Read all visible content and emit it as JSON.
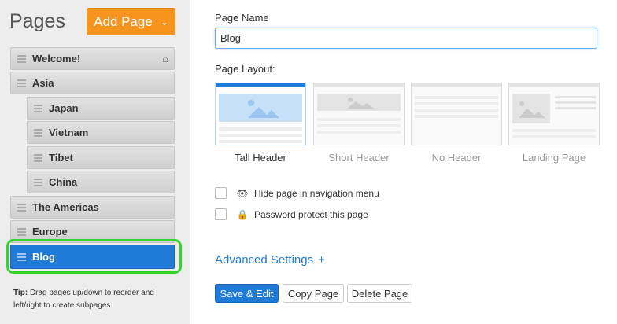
{
  "sidebar": {
    "title": "Pages",
    "add_page_label": "Add Page",
    "pages": [
      {
        "label": "Welcome!",
        "level": 0,
        "home": true
      },
      {
        "label": "Asia",
        "level": 0
      },
      {
        "label": "Japan",
        "level": 1
      },
      {
        "label": "Vietnam",
        "level": 1
      },
      {
        "label": "Tibet",
        "level": 1
      },
      {
        "label": "China",
        "level": 1
      },
      {
        "label": "The Americas",
        "level": 0
      },
      {
        "label": "Europe",
        "level": 0
      },
      {
        "label": "Blog",
        "level": 0,
        "active": true
      }
    ],
    "tip_label": "Tip:",
    "tip_text": "Drag pages up/down to reorder and left/right to create subpages."
  },
  "main": {
    "page_name_label": "Page Name",
    "page_name_value": "Blog",
    "page_layout_label": "Page Layout:",
    "layouts": [
      {
        "label": "Tall Header",
        "selected": true
      },
      {
        "label": "Short Header",
        "selected": false
      },
      {
        "label": "No Header",
        "selected": false
      },
      {
        "label": "Landing Page",
        "selected": false
      }
    ],
    "hide_nav_label": "Hide page in navigation menu",
    "password_label": "Password protect this page",
    "advanced_label": "Advanced Settings",
    "advanced_plus": "+",
    "save_label": "Save & Edit",
    "copy_label": "Copy Page",
    "delete_label": "Delete Page"
  },
  "colors": {
    "accent": "#1f7ad8",
    "add_button": "#f6941d",
    "active_highlight": "#30d62a"
  }
}
